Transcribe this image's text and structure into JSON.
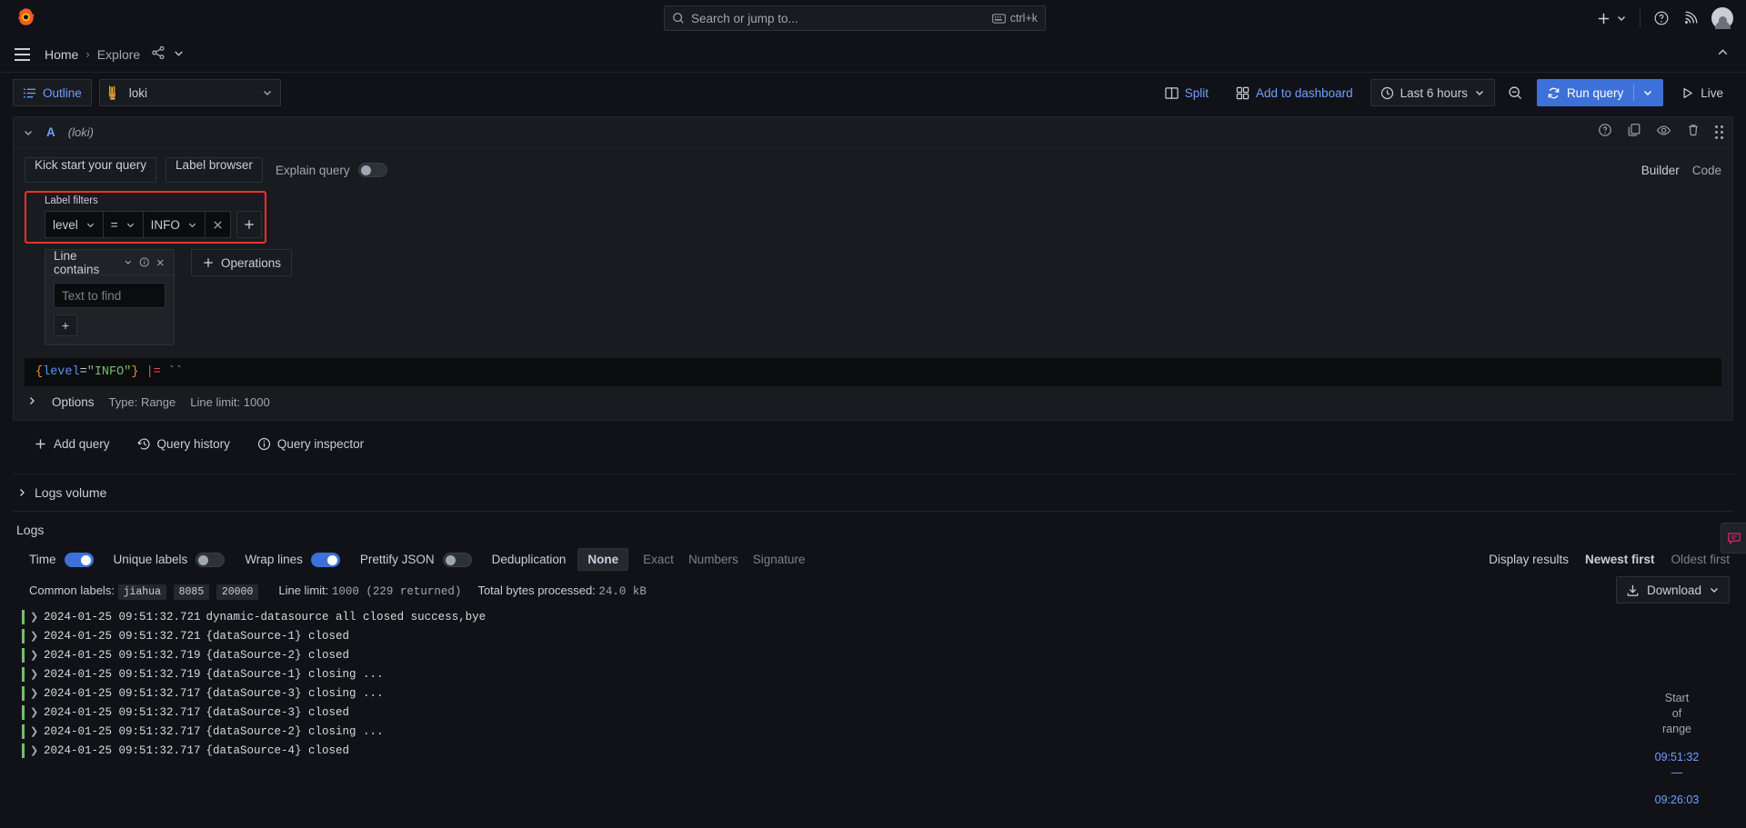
{
  "topbar": {
    "search_placeholder": "Search or jump to...",
    "shortcut": "ctrl+k",
    "search_icon": "search-icon",
    "keyboard_icon": "keyboard-icon",
    "add_icon": "plus-icon",
    "help_icon": "help-circle-icon",
    "news_icon": "rss-feed-icon",
    "avatar_icon": "user-avatar"
  },
  "breadcrumb": {
    "home": "Home",
    "separator": "›",
    "current": "Explore",
    "share_icon": "share-icon",
    "menu_icon": "hamburger-menu-icon",
    "collapse_icon": "chevron-up-icon"
  },
  "toolbar": {
    "outline_label": "Outline",
    "outline_icon": "list-icon",
    "datasource_name": "loki",
    "datasource_icon": "loki-logo",
    "split_label": "Split",
    "split_icon": "split-panes-icon",
    "add_dashboard_label": "Add to dashboard",
    "add_dashboard_icon": "apps-grid-icon",
    "time_range_label": "Last 6 hours",
    "time_range_icon": "clock-icon",
    "zoom_out_icon": "zoom-out-icon",
    "run_query_label": "Run query",
    "run_query_icon": "sync-refresh-icon",
    "live_label": "Live",
    "live_icon": "play-icon"
  },
  "query": {
    "id": "A",
    "datasource": "(loki)",
    "header_icons": {
      "help": "help-circle-icon",
      "duplicate": "copy-icon",
      "toggle_visibility": "eye-icon",
      "remove": "trash-icon",
      "drag": "drag-handle-icon"
    },
    "tabs": {
      "kick_start": "Kick start your query",
      "label_browser": "Label browser",
      "explain_query": "Explain query",
      "explain_enabled": false,
      "mode_builder": "Builder",
      "mode_code": "Code",
      "mode_active": "Builder"
    },
    "label_filters": {
      "title": "Label filters",
      "filter": {
        "key": "level",
        "operator": "=",
        "value": "INFO"
      },
      "remove_icon": "close-x-icon",
      "add_icon": "plus-icon",
      "add_label": "+",
      "highlight_color": "#ff2d2d"
    },
    "operations": {
      "op_name": "Line contains",
      "op_info_icon": "info-circle-icon",
      "op_remove_icon": "close-x-icon",
      "op_input_placeholder": "Text to find",
      "op_input_value": "",
      "op_add_label": "+",
      "add_operations_label": "Operations",
      "add_operations_icon": "plus-icon"
    },
    "preview": {
      "open_brace": "{",
      "label_key": "level",
      "equals": "=",
      "label_value": "\"INFO\"",
      "close_brace": "}",
      "line_filter_op": "|=",
      "line_filter_value": "``"
    },
    "options": {
      "label": "Options",
      "type": "Type: Range",
      "line_limit": "Line limit: 1000",
      "expand_icon": "chevron-right-icon"
    }
  },
  "query_actions": {
    "add_query": "Add query",
    "add_query_icon": "plus-icon",
    "query_history": "Query history",
    "query_history_icon": "history-icon",
    "query_inspector": "Query inspector",
    "query_inspector_icon": "info-circle-icon"
  },
  "logs_volume": {
    "label": "Logs volume",
    "expand_icon": "chevron-right-icon"
  },
  "logs": {
    "title": "Logs",
    "controls": {
      "time_label": "Time",
      "time_on": true,
      "unique_labels_label": "Unique labels",
      "unique_labels_on": false,
      "wrap_lines_label": "Wrap lines",
      "wrap_lines_on": true,
      "prettify_json_label": "Prettify JSON",
      "prettify_json_on": false,
      "dedup_label": "Deduplication",
      "dedup_options": [
        "None",
        "Exact",
        "Numbers",
        "Signature"
      ],
      "dedup_active": "None",
      "display_results_label": "Display results",
      "order_options": [
        "Newest first",
        "Oldest first"
      ],
      "order_active": "Newest first"
    },
    "meta": {
      "common_labels_label": "Common labels:",
      "common_labels": [
        "jiahua",
        "8085",
        "20000"
      ],
      "line_limit_label": "Line limit:",
      "line_limit_value": "1000 (229 returned)",
      "bytes_label": "Total bytes processed:",
      "bytes_value": "24.0 kB",
      "download_label": "Download",
      "download_icon": "download-icon",
      "download_chevron": "chevron-down-icon"
    },
    "rows": [
      {
        "time": "2024-01-25 09:51:32.721",
        "message": "dynamic-datasource all closed success,bye",
        "level_color": "#73bf69"
      },
      {
        "time": "2024-01-25 09:51:32.721",
        "message": "{dataSource-1} closed",
        "level_color": "#73bf69"
      },
      {
        "time": "2024-01-25 09:51:32.719",
        "message": "{dataSource-2} closed",
        "level_color": "#73bf69"
      },
      {
        "time": "2024-01-25 09:51:32.719",
        "message": "{dataSource-1} closing ...",
        "level_color": "#73bf69"
      },
      {
        "time": "2024-01-25 09:51:32.717",
        "message": "{dataSource-3} closing ...",
        "level_color": "#73bf69"
      },
      {
        "time": "2024-01-25 09:51:32.717",
        "message": "{dataSource-3} closed",
        "level_color": "#73bf69"
      },
      {
        "time": "2024-01-25 09:51:32.717",
        "message": "{dataSource-2} closing ...",
        "level_color": "#73bf69"
      },
      {
        "time": "2024-01-25 09:51:32.717",
        "message": "{dataSource-4} closed",
        "level_color": "#73bf69"
      }
    ],
    "range_side": {
      "line1": "Start",
      "line2": "of",
      "line3": "range",
      "time_top": "09:51:32",
      "dash": "—",
      "time_bottom": "09:26:03"
    }
  },
  "feedback": {
    "icon": "feedback-icon"
  }
}
